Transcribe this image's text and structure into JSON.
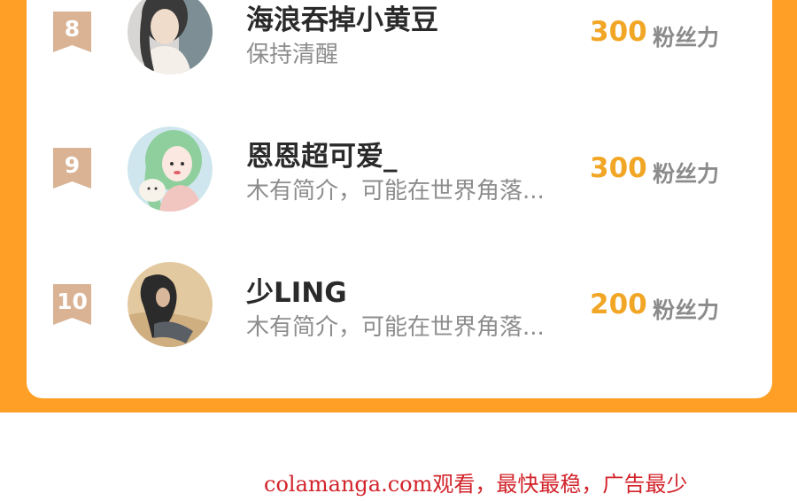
{
  "ranking": {
    "items": [
      {
        "rank": "8",
        "username": "海浪吞掉小黄豆",
        "bio": "保持清醒",
        "score": "300",
        "score_unit": "粉丝力"
      },
      {
        "rank": "9",
        "username": "恩恩超可爱_",
        "bio": "木有简介，可能在世界角落...",
        "score": "300",
        "score_unit": "粉丝力"
      },
      {
        "rank": "10",
        "username": "少LING",
        "bio": "木有简介，可能在世界角落...",
        "score": "200",
        "score_unit": "粉丝力"
      }
    ]
  },
  "watermark": "colamanga.com观看，最快最稳，广告最少",
  "colors": {
    "panel_orange": "#FF9F25",
    "score_orange": "#F1A626",
    "badge_tan": "#D9B394",
    "watermark_red": "#D2232A"
  },
  "icons": {
    "rank_badge": "ribbon-bookmark-icon"
  }
}
